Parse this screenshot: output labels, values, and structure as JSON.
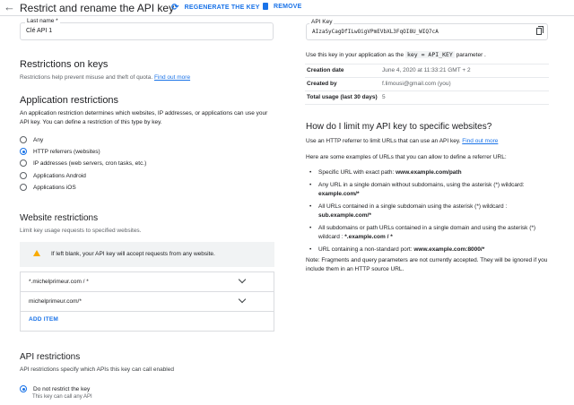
{
  "header": {
    "title": "Restrict and rename the API key",
    "regenerate_label": "REGENERATE THE KEY",
    "remove_label": "REMOVE"
  },
  "name_field": {
    "label": "Last name *",
    "value": "Clé API 1"
  },
  "key_restrictions": {
    "heading": "Restrictions on keys",
    "description": "Restrictions help prevent misuse and theft of quota.",
    "link": "Find out more"
  },
  "app_restrictions": {
    "heading": "Application restrictions",
    "description": "An application restriction determines which websites, IP addresses, or applications can use your API key. You can define a restriction of this type by key.",
    "options": [
      "Any",
      "HTTP referrers (websites)",
      "IP addresses (web servers, cron tasks, etc.)",
      "Applications Android",
      "Applications iOS"
    ],
    "selected_index": 1
  },
  "website_restrictions": {
    "heading": "Website restrictions",
    "description": "Limit key usage requests to specified websites.",
    "warning": "If left blank, your API key will accept requests from any website.",
    "items": [
      "*.michelprimeur.com / *",
      "michelprimeur.com/*"
    ],
    "add_label": "ADD ITEM"
  },
  "api_restrictions": {
    "heading": "API restrictions",
    "description": "API restrictions specify which APIs this key can call enabled",
    "option_label": "Do not restrict the key",
    "option_sub": "This key can call any API"
  },
  "api_key": {
    "label": "API Key",
    "value": "AIzaSyCagDfILwOigVPmEVbXL3FqOI8U_WIQ7cA",
    "usage_prefix": "Use this key in your application as the",
    "usage_code": "key = API_KEY",
    "usage_suffix": "parameter ."
  },
  "info": [
    {
      "key": "Creation date",
      "value": "June 4, 2020 at 11:33:21 GMT + 2"
    },
    {
      "key": "Created by",
      "value": "f.limousi@gmail.com (you)"
    },
    {
      "key": "Total usage (last 30 days)",
      "value": "5"
    }
  ],
  "help": {
    "heading": "How do I limit my API key to specific websites?",
    "intro": "Use an HTTP referrer to limit URLs that can use an API key.",
    "intro_link": "Find out more",
    "examples_intro": "Here are some examples of URLs that you can allow to define a referrer URL:",
    "bullets": [
      {
        "text": "Specific URL with exact path:",
        "bold": "www.example.com/path"
      },
      {
        "text": "Any URL in a single domain without subdomains, using the asterisk (*) wildcard:",
        "bold": "example.com/*"
      },
      {
        "text": "All URLs contained in a single subdomain using the asterisk (*) wildcard :",
        "bold": "sub.example.com/*"
      },
      {
        "text": "All subdomains or path URLs contained in a single domain and using the asterisk (*) wildcard :",
        "bold": "*.example.com / *"
      },
      {
        "text": "URL containing a non-standard port:",
        "bold": "www.example.com:8000/*"
      }
    ],
    "note": "Note: Fragments and query parameters are not currently accepted. They will be ignored if you include them in an HTTP source URL."
  }
}
